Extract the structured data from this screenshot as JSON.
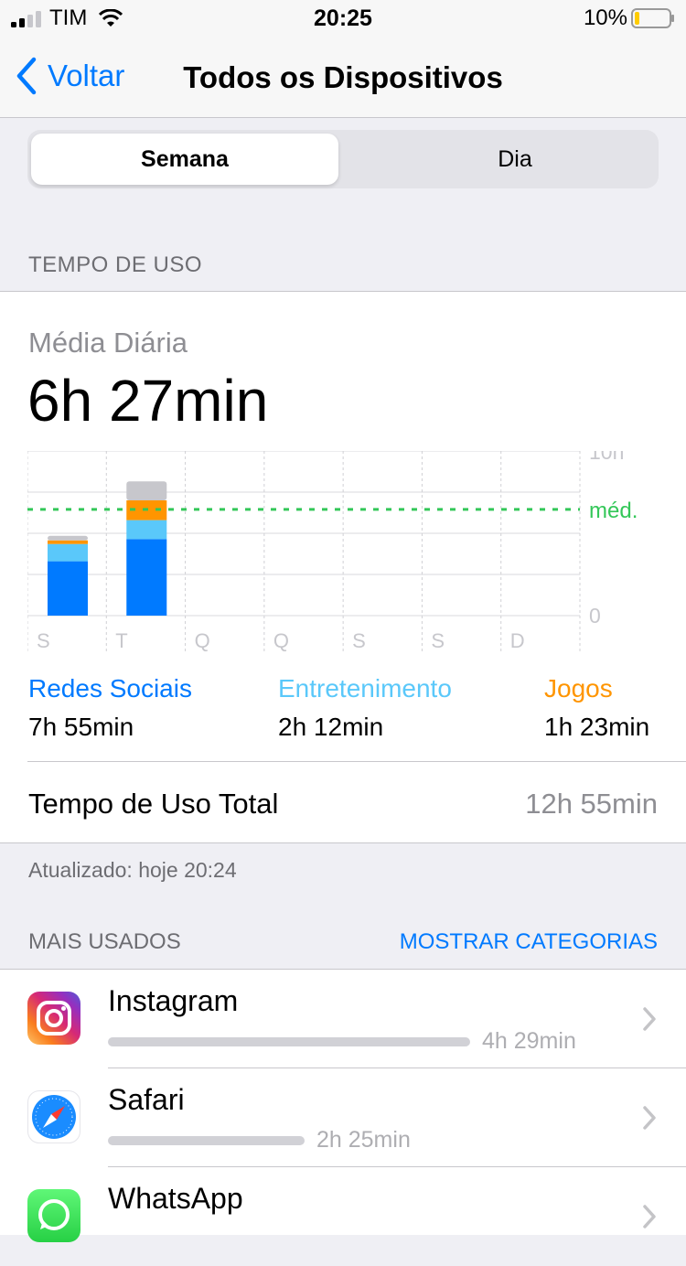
{
  "status": {
    "carrier": "TIM",
    "time": "20:25",
    "battery": "10%"
  },
  "nav": {
    "back_label": "Voltar",
    "title": "Todos os Dispositivos"
  },
  "segment": {
    "selected": "Semana",
    "other": "Dia"
  },
  "sections": {
    "usage": "TEMPO DE USO",
    "most_used": "MAIS USADOS",
    "show_categories": "MOSTRAR CATEGORIAS"
  },
  "summary": {
    "avg_label": "Média Diária",
    "avg_value": "6h 27min"
  },
  "chart_data": {
    "type": "bar",
    "stacked": true,
    "categories": [
      "S",
      "T",
      "Q",
      "Q",
      "S",
      "S",
      "D"
    ],
    "ylim": [
      0,
      10
    ],
    "y_tick_labels": {
      "top": "10h",
      "bottom": "0"
    },
    "average_label": "méd.",
    "average_value": 6.45,
    "series": [
      {
        "name": "Redes Sociais",
        "color": "#007aff",
        "values": [
          3.3,
          4.65,
          0,
          0,
          0,
          0,
          0
        ]
      },
      {
        "name": "Entretenimento",
        "color": "#5ac8fa",
        "values": [
          1.05,
          1.15,
          0,
          0,
          0,
          0,
          0
        ]
      },
      {
        "name": "Jogos",
        "color": "#ff9500",
        "values": [
          0.22,
          1.2,
          0,
          0,
          0,
          0,
          0
        ]
      },
      {
        "color": "#c7c7cc",
        "values": [
          0.28,
          1.15,
          0,
          0,
          0,
          0,
          0
        ]
      }
    ]
  },
  "categories": [
    {
      "name": "Redes Sociais",
      "value": "7h 55min",
      "color": "#007aff"
    },
    {
      "name": "Entretenimento",
      "value": "2h 12min",
      "color": "#5ac8fa"
    },
    {
      "name": "Jogos",
      "value": "1h 23min",
      "color": "#ff9500"
    }
  ],
  "total": {
    "label": "Tempo de Uso Total",
    "value": "12h 55min"
  },
  "updated": "Atualizado: hoje 20:24",
  "apps": [
    {
      "name": "Instagram",
      "duration": "4h 29min",
      "share": 1.0,
      "icon": "instagram-icon"
    },
    {
      "name": "Safari",
      "duration": "2h 25min",
      "share": 0.54,
      "icon": "safari-icon"
    },
    {
      "name": "WhatsApp",
      "duration": "",
      "share": 0.3,
      "icon": "whatsapp-icon"
    }
  ]
}
